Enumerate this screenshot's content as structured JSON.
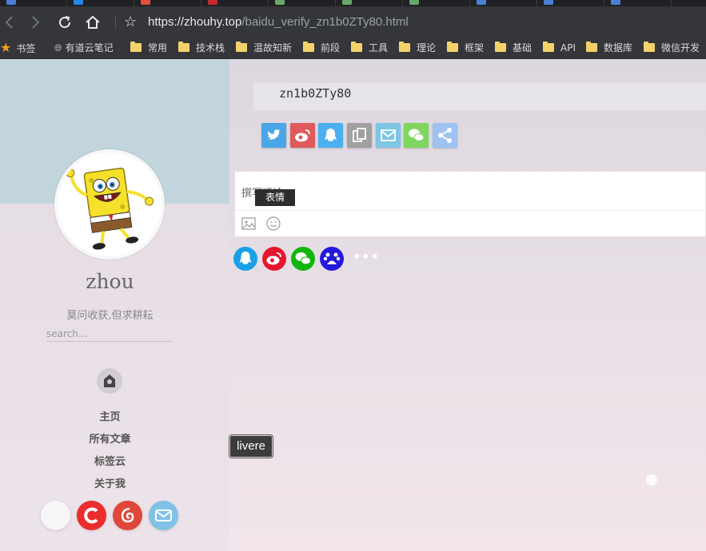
{
  "browser": {
    "tabs": [
      "",
      "",
      "",
      "",
      "",
      "",
      "",
      "",
      "",
      "",
      ""
    ],
    "url_host": "https://zhouhy.top",
    "url_path": "/baidu_verify_zn1b0ZTy80.html",
    "bookmarks": [
      "书签",
      "有道云笔记",
      "常用",
      "技术栈",
      "温故知新",
      "前段",
      "工具",
      "理论",
      "框架",
      "基础",
      "API",
      "数据库",
      "微信开发"
    ]
  },
  "sidebar": {
    "site_name": "zhou",
    "motto": "莫问收获,但求耕耘",
    "search_placeholder": "search...",
    "nav": [
      "主页",
      "所有文章",
      "标签云",
      "关于我"
    ]
  },
  "main": {
    "verify_code": "zn1b0ZTy80",
    "share_buttons": [
      {
        "name": "twitter-icon",
        "color": "#4aa6e6"
      },
      {
        "name": "weibo-icon",
        "color": "#e0595c"
      },
      {
        "name": "qq-icon",
        "color": "#4cb0f0"
      },
      {
        "name": "copy-icon",
        "color": "#a0a0a0"
      },
      {
        "name": "mail-icon",
        "color": "#7fc6e6"
      },
      {
        "name": "wechat-icon",
        "color": "#7ed65e"
      },
      {
        "name": "share-icon",
        "color": "#9ec3f0"
      }
    ],
    "comment_placeholder": "撰写评论",
    "emoji_tooltip": "表情",
    "livere_label": "livere"
  }
}
